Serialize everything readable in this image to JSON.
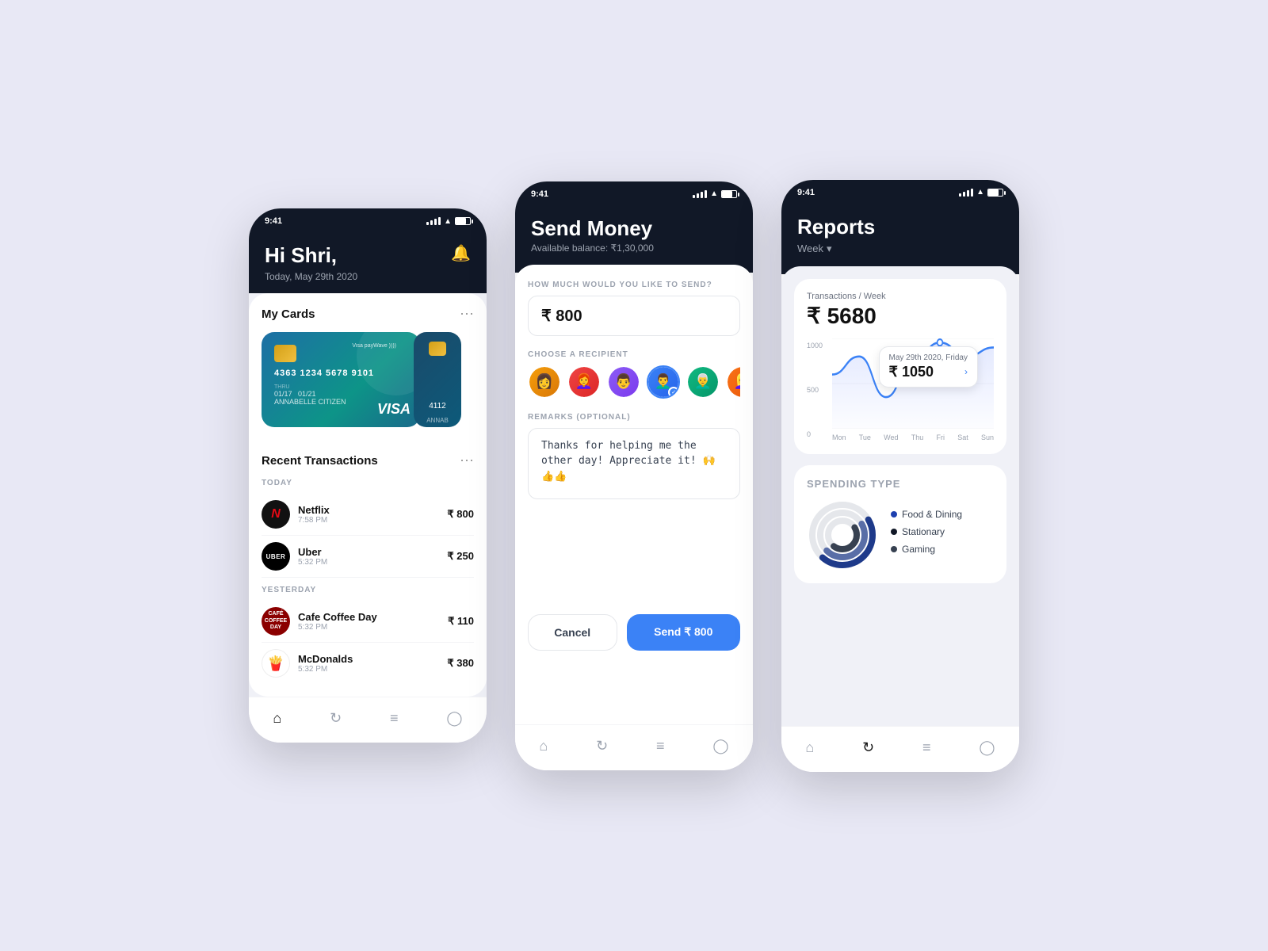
{
  "page": {
    "background": "#e8e8f5"
  },
  "screen1": {
    "statusbar": {
      "time": "9:41"
    },
    "header": {
      "greeting": "Hi Shri,",
      "date": "Today, May 29th 2020",
      "bell": "🔔"
    },
    "cards_section": {
      "title": "My Cards",
      "card1": {
        "number": "4363  1234  5678  9101",
        "expiry_label": "THRU",
        "expiry": "01/17",
        "valid_thru": "01/21",
        "holder": "ANNABELLE CITIZEN",
        "brand": "VISA",
        "paywave": "Visa payWave"
      },
      "card2": {
        "number": "4112",
        "holder": "ANNABE"
      }
    },
    "transactions": {
      "title": "Recent Transactions",
      "today_label": "TODAY",
      "yesterday_label": "YESTERDAY",
      "items_today": [
        {
          "name": "Netflix",
          "time": "7:58 PM",
          "amount": "₹ 800",
          "icon": "N",
          "color": "tx-netflix"
        },
        {
          "name": "Uber",
          "time": "5:32 PM",
          "amount": "₹ 250",
          "icon": "UBER",
          "color": "tx-uber"
        }
      ],
      "items_yesterday": [
        {
          "name": "Cafe Coffee Day",
          "time": "5:32 PM",
          "amount": "₹ 110",
          "icon": "CAFÉ",
          "color": "tx-cafe"
        },
        {
          "name": "McDonalds",
          "time": "5:32 PM",
          "amount": "₹ 380",
          "icon": "🍟",
          "color": "tx-mcd"
        }
      ]
    },
    "nav": [
      "home",
      "refresh",
      "list",
      "user"
    ]
  },
  "screen2": {
    "statusbar": {
      "time": "9:41"
    },
    "header": {
      "title": "Send Money",
      "balance": "Available balance: ₹1,30,000"
    },
    "amount_label": "HOW MUCH WOULD YOU LIKE TO SEND?",
    "amount_value": "₹  800",
    "recipient_label": "CHOOSE A RECIPIENT",
    "recipients": [
      {
        "id": 1,
        "selected": false,
        "color": "av1"
      },
      {
        "id": 2,
        "selected": false,
        "color": "av2"
      },
      {
        "id": 3,
        "selected": false,
        "color": "av3"
      },
      {
        "id": 4,
        "selected": true,
        "color": "av4"
      },
      {
        "id": 5,
        "selected": false,
        "color": "av5"
      },
      {
        "id": 6,
        "selected": false,
        "color": "av6"
      }
    ],
    "remarks_label": "REMARKS (OPTIONAL)",
    "remarks_value": "Thanks for helping me the other day! Appreciate it! 🙌👍👍",
    "cancel_label": "Cancel",
    "send_label": "Send ₹ 800",
    "nav": [
      "home",
      "refresh",
      "list",
      "user"
    ]
  },
  "screen3": {
    "statusbar": {
      "time": "9:41"
    },
    "header": {
      "title": "Reports",
      "period": "Week",
      "period_arrow": "▾"
    },
    "chart": {
      "meta": "Transactions / Week",
      "total": "₹ 5680",
      "tooltip_date": "May 29th 2020, Friday",
      "tooltip_amount": "₹ 1050",
      "y_labels": [
        "1000",
        "500",
        "0"
      ],
      "x_labels": [
        "Mon",
        "Tue",
        "Wed",
        "Thu",
        "Fri",
        "Sat",
        "Sun"
      ],
      "data_points": [
        600,
        800,
        350,
        750,
        1050,
        800,
        900
      ]
    },
    "spending": {
      "title": "SPENDING TYPE",
      "categories": [
        {
          "label": "Food & Dining",
          "color": "#1e40af",
          "pct": 45
        },
        {
          "label": "Stationary",
          "color": "#111827",
          "pct": 30
        },
        {
          "label": "Gaming",
          "color": "#374151",
          "pct": 25
        }
      ]
    },
    "nav": [
      "home",
      "refresh",
      "list",
      "user"
    ]
  }
}
